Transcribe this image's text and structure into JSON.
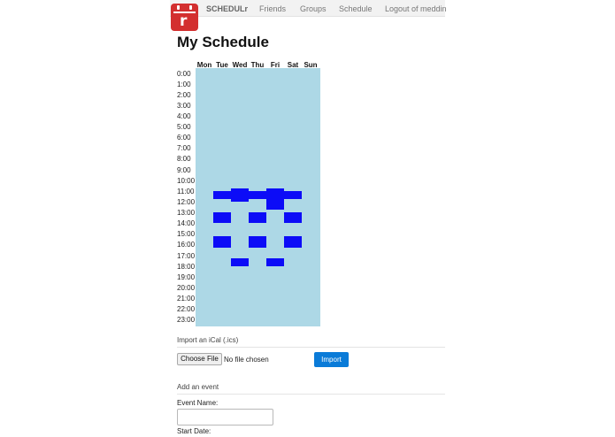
{
  "nav": {
    "brand": "SCHEDULr",
    "logo_glyph": "r",
    "links": [
      "Friends",
      "Groups",
      "Schedule",
      "Logout of meddin"
    ]
  },
  "page": {
    "title": "My Schedule"
  },
  "schedule": {
    "days": [
      "Mon",
      "Tue",
      "Wed",
      "Thu",
      "Fri",
      "Sat",
      "Sun"
    ],
    "hours": [
      "0:00",
      "1:00",
      "2:00",
      "3:00",
      "4:00",
      "5:00",
      "6:00",
      "7:00",
      "8:00",
      "9:00",
      "10:00",
      "11:00",
      "12:00",
      "13:00",
      "14:00",
      "15:00",
      "16:00",
      "17:00",
      "18:00",
      "19:00",
      "20:00",
      "21:00",
      "22:00",
      "23:00"
    ],
    "events": [
      {
        "day": 1,
        "start": 11.0,
        "end": 11.75
      },
      {
        "day": 2,
        "start": 10.75,
        "end": 12.0
      },
      {
        "day": 3,
        "start": 11.0,
        "end": 11.75
      },
      {
        "day": 4,
        "start": 10.75,
        "end": 12.75
      },
      {
        "day": 5,
        "start": 11.0,
        "end": 11.75
      },
      {
        "day": 1,
        "start": 13.0,
        "end": 14.0
      },
      {
        "day": 3,
        "start": 13.0,
        "end": 14.0
      },
      {
        "day": 5,
        "start": 13.0,
        "end": 14.0
      },
      {
        "day": 1,
        "start": 15.25,
        "end": 16.25
      },
      {
        "day": 3,
        "start": 15.25,
        "end": 16.25
      },
      {
        "day": 5,
        "start": 15.25,
        "end": 16.25
      },
      {
        "day": 2,
        "start": 17.25,
        "end": 18.0
      },
      {
        "day": 4,
        "start": 17.25,
        "end": 18.0
      }
    ],
    "grid_color": "#add8e6",
    "event_color": "#0c0cf7"
  },
  "import_section": {
    "title": "Import an iCal (.ics)",
    "choose_file_label": "Choose File",
    "file_status": "No file chosen",
    "import_label": "Import"
  },
  "add_event_section": {
    "title": "Add an event",
    "event_name_label": "Event Name:",
    "event_name_value": "",
    "start_date_label": "Start Date:"
  }
}
